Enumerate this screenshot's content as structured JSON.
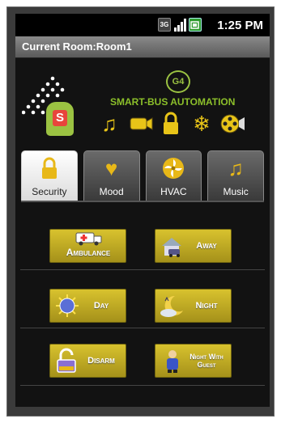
{
  "status_bar": {
    "time": "1:25 PM",
    "icons": [
      "3g-icon",
      "signal-icon",
      "battery-icon"
    ],
    "network_label": "3G"
  },
  "title_bar": {
    "title": "Current Room:Room1"
  },
  "header": {
    "badge": "G4",
    "brand": "SMART-BUS AUTOMATION",
    "logo_letter": "S",
    "icons": [
      "music-icon",
      "camera-icon",
      "lock-icon",
      "snowflake-icon",
      "film-reel-icon"
    ]
  },
  "tabs": [
    {
      "label": "Security",
      "icon": "lock-icon",
      "active": true
    },
    {
      "label": "Mood",
      "icon": "heart-icon",
      "active": false
    },
    {
      "label": "HVAC",
      "icon": "fan-icon",
      "active": false
    },
    {
      "label": "Music",
      "icon": "music-icon",
      "active": false
    }
  ],
  "buttons": [
    {
      "label": "Ambulance",
      "icon": "ambulance-icon"
    },
    {
      "label": "Away",
      "icon": "car-house-icon"
    },
    {
      "label": "Day",
      "icon": "sun-icon"
    },
    {
      "label": "Night",
      "icon": "moon-icon"
    },
    {
      "label": "Disarm",
      "icon": "unlock-icon"
    },
    {
      "label": "Night With Guest",
      "icon": "guest-icon"
    }
  ],
  "colors": {
    "accent": "#9bc242",
    "button": "#c8b22a",
    "brand_text": "#8cbf2a"
  }
}
